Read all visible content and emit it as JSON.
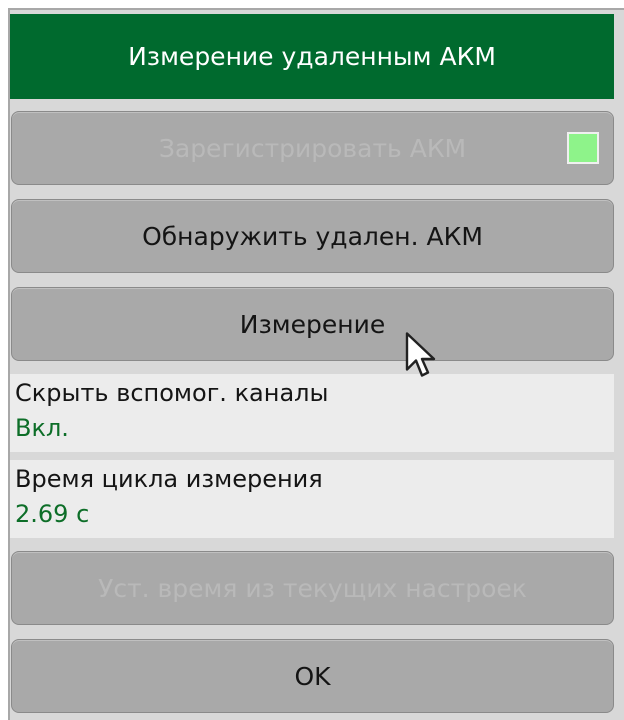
{
  "panel": {
    "title": "Измерение удаленным АКМ"
  },
  "buttons": {
    "register_label": "Зарегистрировать АКМ",
    "register_indicator_color": "#8ef38a",
    "detect_label": "Обнаружить удален. АКМ",
    "measure_label": "Измерение",
    "set_time_label": "Уст. время из текущих настроек",
    "ok_label": "OK"
  },
  "fields": {
    "hide_aux": {
      "label": "Скрыть вспомог. каналы",
      "value": "Вкл."
    },
    "cycle_time": {
      "label": "Время цикла измерения",
      "value": "2.69 с"
    }
  },
  "colors": {
    "header_bg": "#006a2e",
    "button_bg": "#a9a9a9",
    "value_text": "#0d6e28",
    "disabled_text": "#b9b9b9"
  }
}
